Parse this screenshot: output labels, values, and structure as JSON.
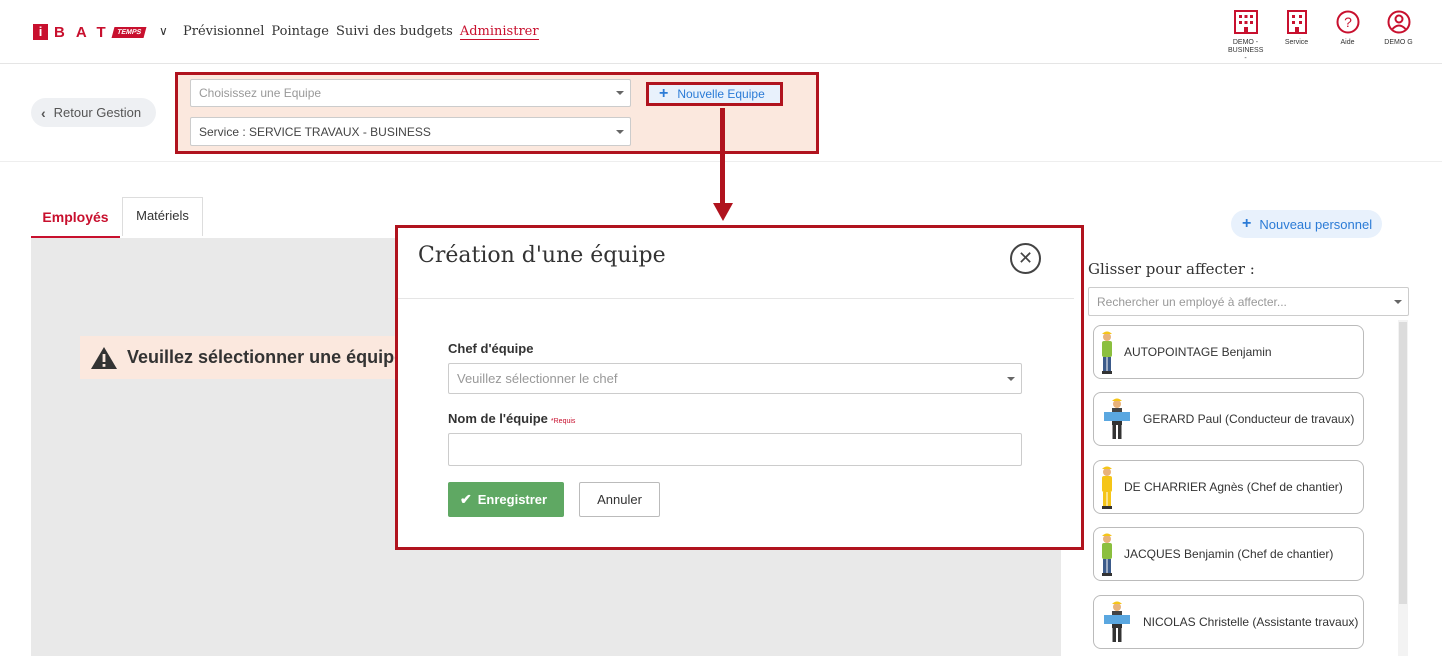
{
  "app": {
    "logo_letters": "BAT",
    "logo_i": "i",
    "logo_sub": "TEMPS",
    "colors": {
      "brand": "#c8102e",
      "highlight_border": "#b0131e",
      "link_blue": "#2b7bd6",
      "save_green": "#5fa863"
    }
  },
  "nav": {
    "items": [
      "Prévisionnel",
      "Pointage",
      "Suivi des budgets",
      "Administrer"
    ],
    "active_index": 3
  },
  "top_icons": [
    {
      "icon": "building-icon",
      "label": "DEMO - BUSINESS -"
    },
    {
      "icon": "building-icon",
      "label": "Service"
    },
    {
      "icon": "help-icon",
      "label": "Aide"
    },
    {
      "icon": "user-icon",
      "label": "DEMO G"
    }
  ],
  "filters": {
    "back_label": "Retour Gestion",
    "equipe_placeholder": "Choisissez une Equipe",
    "service_value": "Service : SERVICE TRAVAUX - BUSINESS",
    "new_team_label": "Nouvelle Equipe"
  },
  "tabs": {
    "employes": "Employés",
    "materiels": "Matériels"
  },
  "warning": {
    "text": "Veuillez sélectionner une équipe"
  },
  "modal": {
    "title": "Création d'une équipe",
    "chef_label": "Chef d'équipe",
    "chef_placeholder": "Veuillez sélectionner le chef",
    "nom_label": "Nom de l'équipe",
    "required_mark": "*Requis",
    "nom_value": "",
    "save_label": "Enregistrer",
    "cancel_label": "Annuler"
  },
  "right_panel": {
    "new_staff_label": "Nouveau personnel",
    "glisser_label": "Glisser pour affecter :",
    "search_placeholder": "Rechercher un employé à affecter...",
    "employees": [
      {
        "name": "AUTOPOINTAGE Benjamin",
        "figure": "worker-icon"
      },
      {
        "name": "GERARD Paul (Conducteur de travaux)",
        "figure": "foreman-icon"
      },
      {
        "name": "DE CHARRIER Agnès (Chef de chantier)",
        "figure": "worker-icon"
      },
      {
        "name": "JACQUES Benjamin (Chef de chantier)",
        "figure": "worker-icon"
      },
      {
        "name": "NICOLAS Christelle (Assistante travaux)",
        "figure": "foreman-icon"
      }
    ]
  }
}
